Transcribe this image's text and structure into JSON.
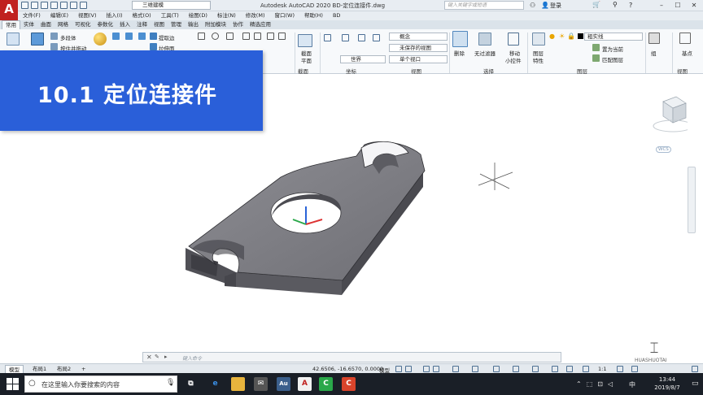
{
  "titlebar": {
    "logo": "A",
    "workspace": "三维建模",
    "title": "Autodesk AutoCAD 2020    BD-定位连接件.dwg",
    "search_placeholder": "键入关键字或短语",
    "login": "登录",
    "help": "?"
  },
  "menus": [
    "文件(F)",
    "编辑(E)",
    "视图(V)",
    "插入(I)",
    "格式(O)",
    "工具(T)",
    "绘图(D)",
    "标注(N)",
    "修改(M)",
    "窗口(W)",
    "帮助(H)",
    "BD"
  ],
  "tabs": [
    "常用",
    "实体",
    "曲面",
    "网格",
    "可视化",
    "参数化",
    "插入",
    "注释",
    "视图",
    "管理",
    "输出",
    "附加模块",
    "协作",
    "精选应用"
  ],
  "ribbon": {
    "polysolid": "多段体",
    "smooth": "按住并拖动",
    "extract": "提取边",
    "extrude": "拉伸面",
    "visual_style": "概念",
    "saved_view": "未保存的视图",
    "ucs": "世界",
    "single_viewport": "单个视口",
    "section_plane_top": "截面",
    "section_plane_bottom": "平面",
    "section_label": "截面",
    "coords_label": "坐标",
    "view_label": "视图",
    "delete": "删除",
    "no_filter": "无过滤器",
    "selection_label": "选择",
    "move_gizmo_top": "移动",
    "move_gizmo_bottom": "小控件",
    "layer_props_top": "图层",
    "layer_props_bottom": "特性",
    "layer_name": "粗实线",
    "set_current": "置为当前",
    "match_layer": "匹配图层",
    "layers_label": "图层",
    "group": "组",
    "base": "基点",
    "view2": "视图"
  },
  "banner": {
    "text": "10.1  定位连接件"
  },
  "viewcube": {
    "wcs": "WCS"
  },
  "cmd": {
    "placeholder": "键入命令",
    "close": "✕"
  },
  "layouts": [
    "模型",
    "布局1",
    "布局2"
  ],
  "status": {
    "coords": "42.6506, -16.6570, 0.0000",
    "model": "模型",
    "scale": "1:1"
  },
  "taskbar": {
    "search": "在这里输入你要搜索的内容",
    "time": "13:44",
    "date": "2019/8/7",
    "lang": "中"
  },
  "watermark": {
    "text": "HUASHUOTAI"
  }
}
